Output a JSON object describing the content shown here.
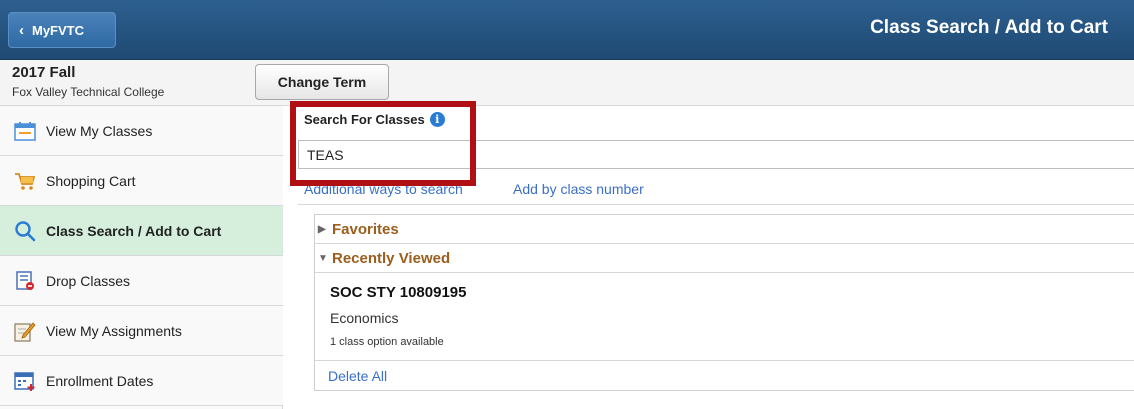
{
  "header": {
    "back_label": "MyFVTC",
    "title": "Class Search / Add to Cart"
  },
  "term": {
    "name": "2017 Fall",
    "college": "Fox Valley Technical College",
    "change_label": "Change Term"
  },
  "sidebar": {
    "items": [
      {
        "label": "View My Classes",
        "icon": "calendar-icon"
      },
      {
        "label": "Shopping Cart",
        "icon": "shopping-cart-icon"
      },
      {
        "label": "Class Search / Add to Cart",
        "icon": "search-icon",
        "active": true
      },
      {
        "label": "Drop Classes",
        "icon": "drop-list-icon"
      },
      {
        "label": "View My Assignments",
        "icon": "pencil-notepad-icon"
      },
      {
        "label": "Enrollment Dates",
        "icon": "calendar-add-icon"
      }
    ]
  },
  "search": {
    "label": "Search For Classes",
    "value": "TEAS",
    "additional_link": "Additional ways to search",
    "add_by_number_link": "Add by class number"
  },
  "favorites": {
    "label": "Favorites"
  },
  "recently_viewed": {
    "label": "Recently Viewed",
    "course_code": "SOC STY 10809195",
    "course_name": "Economics",
    "options": "1 class option available",
    "delete_all": "Delete All"
  },
  "colors": {
    "header": "#1f4a73",
    "active_nav": "#d6efdc",
    "section_heading": "#9b5e1d",
    "link": "#3a6fc8",
    "highlight_box": "#b00f14"
  }
}
